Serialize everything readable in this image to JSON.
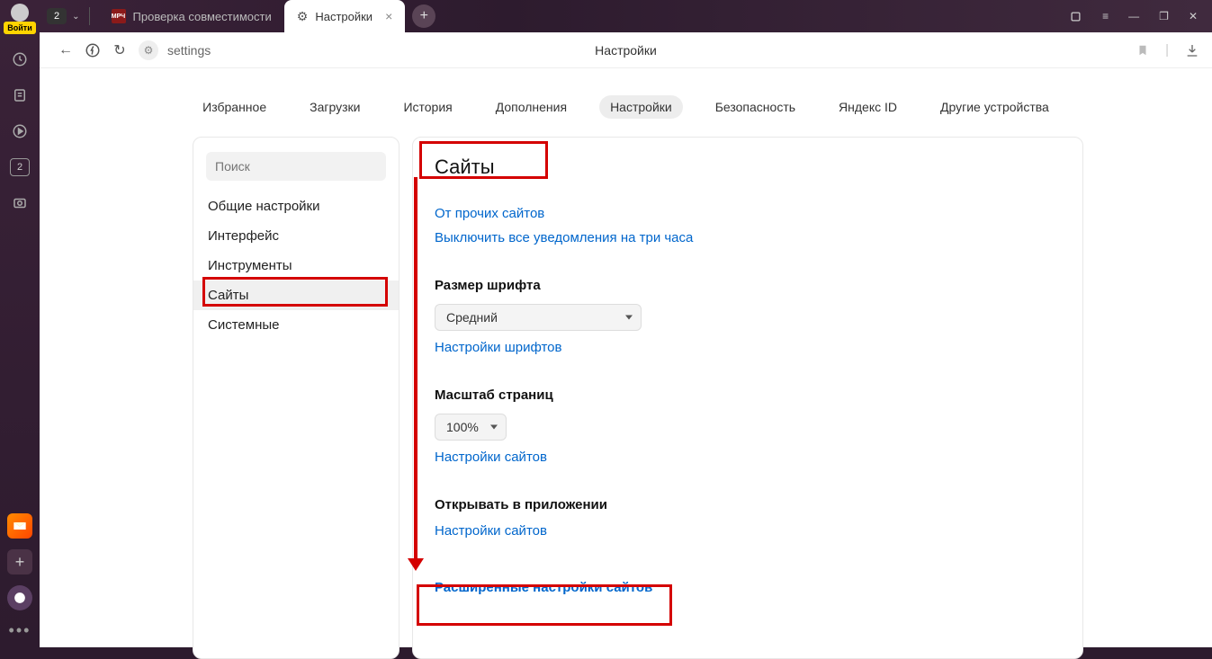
{
  "left_strip": {
    "login_label": "Войти",
    "tab_count": "2"
  },
  "tabs": {
    "counter": "2",
    "tab1_favicon_text": "МРЧ",
    "tab1_label": "Проверка совместимости",
    "tab2_label": "Настройки"
  },
  "window": {
    "min": "—",
    "max": "⧉",
    "close": "✕",
    "ext": "⧉",
    "menu": "≡"
  },
  "addr": {
    "url_text": "settings",
    "page_title": "Настройки"
  },
  "top_nav": {
    "items": [
      "Избранное",
      "Загрузки",
      "История",
      "Дополнения",
      "Настройки",
      "Безопасность",
      "Яндекс ID",
      "Другие устройства"
    ],
    "active_index": 4
  },
  "sidebar": {
    "search_placeholder": "Поиск",
    "items": [
      "Общие настройки",
      "Интерфейс",
      "Инструменты",
      "Сайты",
      "Системные"
    ],
    "active_index": 3
  },
  "main": {
    "heading": "Сайты",
    "link_other_sites": "От прочих сайтов",
    "link_disable_notifs": "Выключить все уведомления на три часа",
    "font_size_label": "Размер шрифта",
    "font_size_value": "Средний",
    "font_settings_link": "Настройки шрифтов",
    "zoom_label": "Масштаб страниц",
    "zoom_value": "100%",
    "site_settings_link": "Настройки сайтов",
    "open_in_app_label": "Открывать в приложении",
    "site_settings_link2": "Настройки сайтов",
    "advanced_link": "Расширенные настройки сайтов"
  }
}
